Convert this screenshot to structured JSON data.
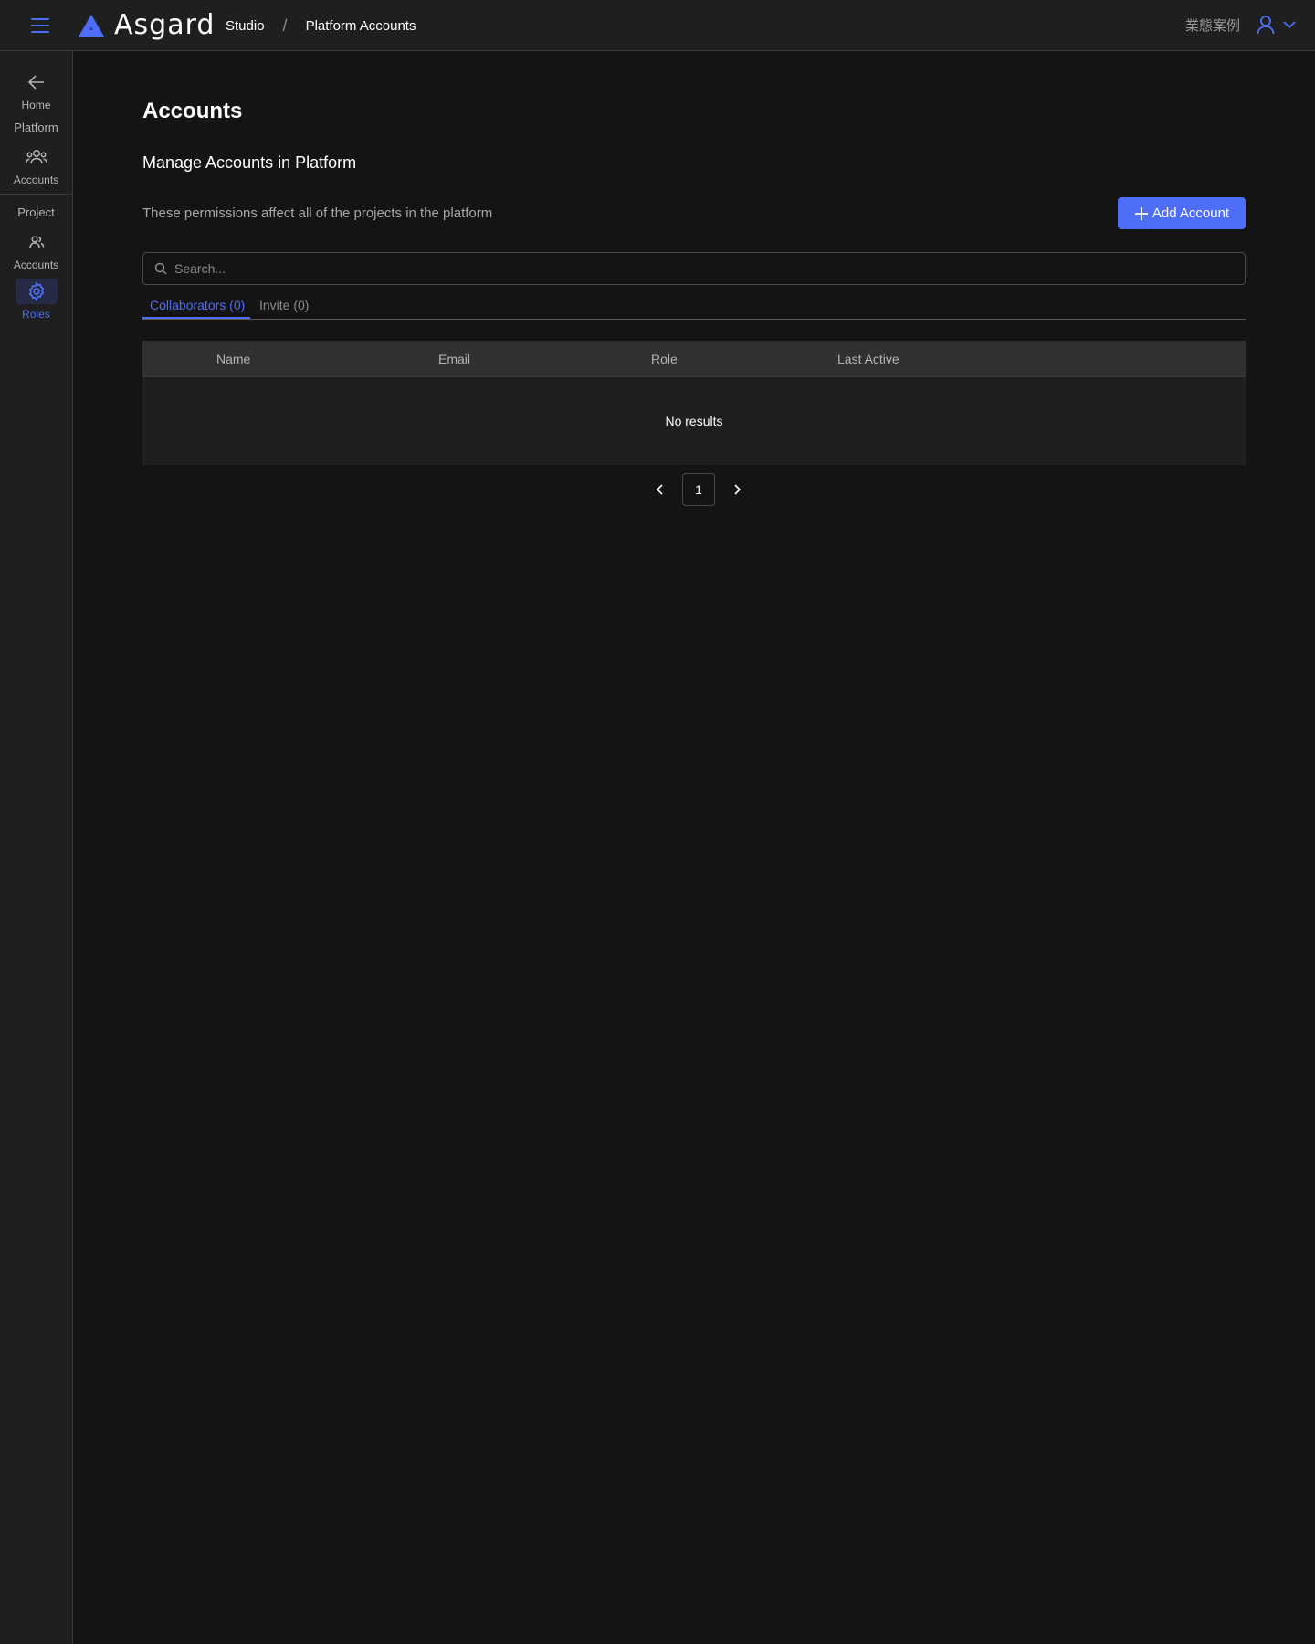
{
  "header": {
    "app_name": "Asgard",
    "breadcrumbs": [
      "Studio",
      "Platform Accounts"
    ],
    "separator": "/",
    "org_name": "業態案例",
    "accent": "#4f6ef7"
  },
  "sidebar": {
    "home_label": "Home",
    "platform_section": "Platform",
    "platform_accounts_label": "Accounts",
    "project_section": "Project",
    "project_accounts_label": "Accounts",
    "roles_label": "Roles",
    "active_item": "Roles"
  },
  "main": {
    "title": "Accounts",
    "section_title": "Manage Accounts in Platform",
    "description": "These permissions affect all of the projects in the platform",
    "add_button_label": "Add Account",
    "search_placeholder": "Search...",
    "tabs": [
      {
        "label": "Collaborators (0)",
        "active": true
      },
      {
        "label": "Invite (0)",
        "active": false
      }
    ],
    "table": {
      "columns": [
        "Name",
        "Email",
        "Role",
        "Last Active"
      ],
      "rows": [],
      "empty_text": "No results"
    },
    "pagination": {
      "current_page": "1"
    }
  }
}
